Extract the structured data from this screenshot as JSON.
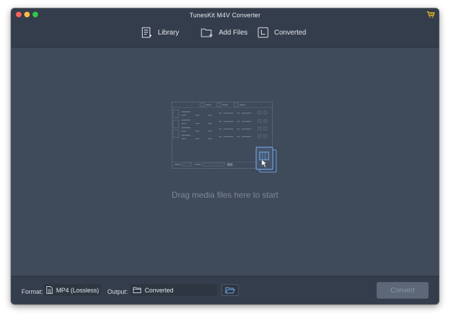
{
  "window": {
    "title": "TunesKit M4V Converter"
  },
  "toolbar": {
    "library_label": "Library",
    "add_files_label": "Add Files",
    "converted_label": "Converted"
  },
  "main": {
    "drop_hint": "Drag media files here to start"
  },
  "bottom": {
    "format_label": "Format:",
    "format_value": "MP4 (Lossless)",
    "output_label": "Output:",
    "output_value": "Converted",
    "convert_label": "Convert"
  },
  "colors": {
    "window_bg": "#3f4a5a",
    "titlebar_bg": "#343d4b",
    "accent_blue": "#6fa3e0",
    "cart_yellow": "#f0c020",
    "drop_text": "#7c8797"
  },
  "icons": [
    "cart-icon",
    "library-icon",
    "add-files-icon",
    "converted-icon",
    "file-icon",
    "folder-icon",
    "open-folder-icon"
  ]
}
